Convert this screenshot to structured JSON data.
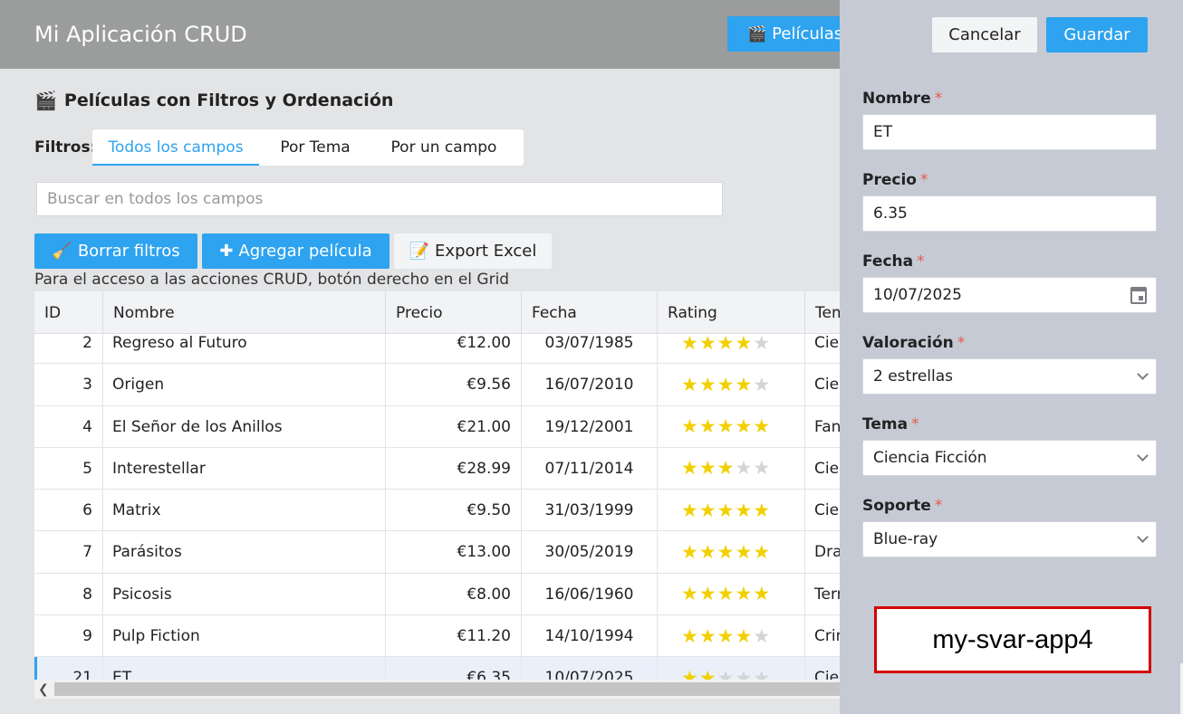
{
  "app": {
    "title": "Mi Aplicación CRUD"
  },
  "nav": {
    "movies_label": "Películas",
    "movies_icon": "clapperboard-icon"
  },
  "page": {
    "heading": "Películas con Filtros y Ordenación",
    "heading_icon": "clapperboard-icon"
  },
  "filters": {
    "label": "Filtros:",
    "tabs": [
      {
        "label": "Todos los campos",
        "active": true
      },
      {
        "label": "Por Tema",
        "active": false
      },
      {
        "label": "Por un campo",
        "active": false
      }
    ]
  },
  "search": {
    "placeholder": "Buscar en todos los campos",
    "value": ""
  },
  "toolbar": {
    "clear_label": "Borrar filtros",
    "add_label": "Agregar película",
    "export_label": "Export Excel"
  },
  "hint": "Para el acceso a las acciones CRUD, botón derecho en el Grid",
  "grid": {
    "columns": [
      "ID",
      "Nombre",
      "Precio",
      "Fecha",
      "Rating",
      "Tema"
    ],
    "rows": [
      {
        "id": "2",
        "name": "Regreso al Futuro",
        "price": "€12.00",
        "date": "03/07/1985",
        "rating": 4,
        "tema": "Ciencia Ficción"
      },
      {
        "id": "3",
        "name": "Origen",
        "price": "€9.56",
        "date": "16/07/2010",
        "rating": 4,
        "tema": "Ciencia Ficción"
      },
      {
        "id": "4",
        "name": "El Señor de los Anillos",
        "price": "€21.00",
        "date": "19/12/2001",
        "rating": 5,
        "tema": "Fantasía"
      },
      {
        "id": "5",
        "name": "Interestellar",
        "price": "€28.99",
        "date": "07/11/2014",
        "rating": 3,
        "tema": "Ciencia Ficción"
      },
      {
        "id": "6",
        "name": "Matrix",
        "price": "€9.50",
        "date": "31/03/1999",
        "rating": 5,
        "tema": "Ciencia Ficción"
      },
      {
        "id": "7",
        "name": "Parásitos",
        "price": "€13.00",
        "date": "30/05/2019",
        "rating": 5,
        "tema": "Drama"
      },
      {
        "id": "8",
        "name": "Psicosis",
        "price": "€8.00",
        "date": "16/06/1960",
        "rating": 5,
        "tema": "Terror"
      },
      {
        "id": "9",
        "name": "Pulp Fiction",
        "price": "€11.20",
        "date": "14/10/1994",
        "rating": 4,
        "tema": "Crimen"
      },
      {
        "id": "21",
        "name": "ET",
        "price": "€6.35",
        "date": "10/07/2025",
        "rating": 2,
        "tema": "Ciencia Ficción",
        "selected": true
      }
    ]
  },
  "editor": {
    "cancel_label": "Cancelar",
    "save_label": "Guardar",
    "fields": {
      "nombre": {
        "label": "Nombre",
        "value": "ET"
      },
      "precio": {
        "label": "Precio",
        "value": "6.35"
      },
      "fecha": {
        "label": "Fecha",
        "value": "10/07/2025"
      },
      "valoracion": {
        "label": "Valoración",
        "value": "2 estrellas"
      },
      "tema": {
        "label": "Tema",
        "value": "Ciencia Ficción"
      },
      "soporte": {
        "label": "Soporte",
        "value": "Blue-ray"
      }
    },
    "required_mark": "*"
  },
  "watermark": "my-svar-app4",
  "colors": {
    "accent": "#2ea3ef",
    "star": "#f2d000",
    "required": "#e85a4f",
    "topbar": "#9b9c9c",
    "panel": "#c6cad4"
  }
}
